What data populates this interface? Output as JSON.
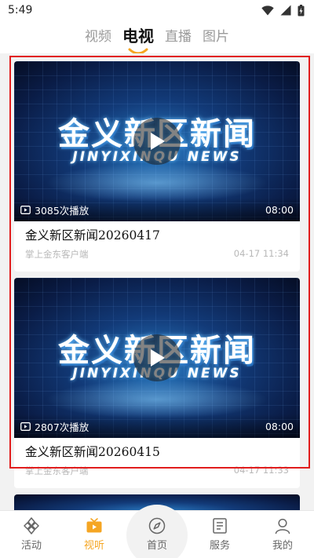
{
  "status_bar": {
    "time": "5:49"
  },
  "top_tabs": [
    {
      "label": "视频",
      "active": false
    },
    {
      "label": "电视",
      "active": true
    },
    {
      "label": "直播",
      "active": false
    },
    {
      "label": "图片",
      "active": false
    }
  ],
  "colors": {
    "accent": "#f5a623",
    "highlight": "#e11d1d"
  },
  "videos": [
    {
      "thumb_title_cn": "金义新区新闻",
      "thumb_title_en": "JINYIXINQU  NEWS",
      "plays": "3085次播放",
      "duration": "08:00",
      "title": "金义新区新闻20260417",
      "source": "掌上金东客户端",
      "time": "04-17  11:34"
    },
    {
      "thumb_title_cn": "金义新区新闻",
      "thumb_title_en": "JINYIXINQU  NEWS",
      "plays": "2807次播放",
      "duration": "08:00",
      "title": "金义新区新闻20260415",
      "source": "掌上金东客户端",
      "time": "04-17  11:33"
    }
  ],
  "bottom_nav": [
    {
      "label": "活动",
      "icon": "activity-icon",
      "active": false
    },
    {
      "label": "视听",
      "icon": "tv-icon",
      "active": true
    },
    {
      "label": "首页",
      "icon": "compass-icon",
      "active": false
    },
    {
      "label": "服务",
      "icon": "service-icon",
      "active": false
    },
    {
      "label": "我的",
      "icon": "profile-icon",
      "active": false
    }
  ]
}
